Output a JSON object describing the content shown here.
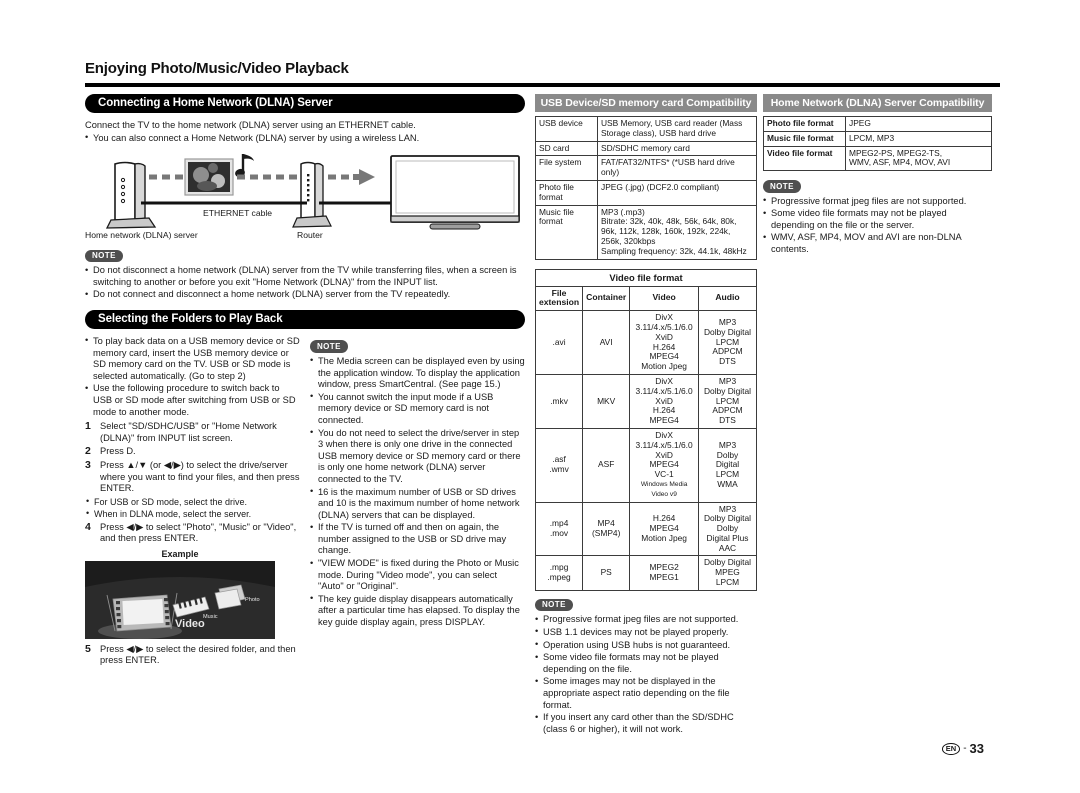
{
  "chapter": {
    "title": "Enjoying Photo/Music/Video Playback"
  },
  "left": {
    "section1_title": "Connecting a Home Network (DLNA) Server",
    "intro_line": "Connect the TV to the home network (DLNA) server using an ETHERNET cable.",
    "intro_bullet": "You can also connect a Home Network (DLNA) server by using a wireless LAN.",
    "diagram": {
      "server_label": "Home network (DLNA) server",
      "cable_label": "ETHERNET cable",
      "router_label": "Router"
    },
    "note_badge": "NOTE",
    "notes": [
      "Do not disconnect a home network (DLNA) server from the TV while transferring files, when a screen is switching to another or before you exit \"Home Network (DLNA)\" from the INPUT list.",
      "Do not connect and disconnect a home network (DLNA) server from the TV repeatedly."
    ],
    "section2_title": "Selecting the Folders to Play Back",
    "pre_bullets": [
      "To play back data on a USB memory device or SD memory card, insert the USB memory device or SD memory card on the TV. USB or SD mode is selected automatically. (Go to step 2)",
      "Use the following procedure to switch back to USB or SD mode after switching from USB or SD mode to another mode."
    ],
    "steps": [
      {
        "num": "1",
        "text": "Select \"SD/SDHC/USB\" or \"Home Network (DLNA)\" from INPUT list screen."
      },
      {
        "num": "2",
        "text": "Press D."
      },
      {
        "num": "3",
        "text": "Press ▲/▼ (or ◀/▶) to select the drive/server where you want to find your files, and then press ENTER.",
        "subs": [
          "For USB or SD mode, select the drive.",
          "When in DLNA mode, select the server."
        ]
      },
      {
        "num": "4",
        "text": "Press ◀/▶ to select \"Photo\", \"Music\" or \"Video\", and then press ENTER."
      },
      {
        "num": "5",
        "text": "Press ◀/▶ to select the desired folder, and then press ENTER."
      }
    ],
    "example_caption": "Example",
    "example_labels": {
      "photo": "Photo",
      "music": "Music",
      "video": "Video"
    },
    "side_note_badge": "NOTE",
    "side_notes": [
      "The Media screen can be displayed even by using the application window. To display the application window, press SmartCentral. (See page 15.)",
      "You cannot switch the input mode if a USB memory device or SD memory card is not connected.",
      "You do not need to select the drive/server in step 3 when there is only one drive in the connected USB memory device or SD memory card or there is only one home network (DLNA) server connected to the TV.",
      "16 is the maximum number of USB or SD drives and 10 is the maximum number of home network (DLNA) servers that can be displayed.",
      "If the TV is turned off and then on again, the number assigned to the USB or SD drive may change.",
      "\"VIEW MODE\" is fixed during the Photo or Music mode. During \"Video mode\", you can select \"Auto\" or \"Original\".",
      "The key guide display disappears automatically after a particular time has elapsed. To display the key guide display again, press DISPLAY."
    ]
  },
  "mid": {
    "usb_table_title": "USB Device/SD memory card Compatibility",
    "usb_rows": [
      {
        "label": "USB device",
        "value": "USB Memory, USB card reader (Mass Storage class), USB hard drive"
      },
      {
        "label": "SD card",
        "value": "SD/SDHC memory card"
      },
      {
        "label": "File system",
        "value": "FAT/FAT32/NTFS* (*USB hard drive only)"
      },
      {
        "label": "Photo file format",
        "value": "JPEG (.jpg) (DCF2.0 compliant)"
      },
      {
        "label": "Music file format",
        "value": "MP3 (.mp3)\nBitrate: 32k, 40k, 48k, 56k, 64k, 80k, 96k, 112k, 128k, 160k, 192k, 224k, 256k, 320kbps\nSampling frequency: 32k, 44.1k, 48kHz"
      }
    ],
    "video_table_title": "Video file format",
    "video_headers": [
      "File extension",
      "Container",
      "Video",
      "Audio"
    ],
    "video_rows": [
      {
        "ext": ".avi",
        "container": "AVI",
        "video": [
          "DivX 3.11/4.x/5.1/6.0",
          "XviD",
          "H.264",
          "MPEG4",
          "Motion Jpeg"
        ],
        "audio": [
          "MP3",
          "Dolby Digital",
          "LPCM",
          "ADPCM",
          "DTS"
        ]
      },
      {
        "ext": ".mkv",
        "container": "MKV",
        "video": [
          "DivX 3.11/4.x/5.1/6.0",
          "XviD",
          "H.264",
          "MPEG4"
        ],
        "audio": [
          "MP3",
          "Dolby Digital",
          "LPCM",
          "ADPCM",
          "DTS"
        ]
      },
      {
        "ext": ".asf\n.wmv",
        "container": "ASF",
        "video": [
          "DivX 3.11/4.x/5.1/6.0",
          "XviD",
          "MPEG4",
          "VC-1",
          "Windows Media Video v9"
        ],
        "audio": [
          "MP3",
          "Dolby",
          "Digital",
          "LPCM",
          "WMA"
        ]
      },
      {
        "ext": ".mp4\n.mov",
        "container": "MP4\n(SMP4)",
        "video": [
          "H.264",
          "MPEG4",
          "Motion Jpeg"
        ],
        "audio": [
          "MP3",
          "Dolby Digital",
          "Dolby",
          "Digital Plus",
          "AAC"
        ]
      },
      {
        "ext": ".mpg\n.mpeg",
        "container": "PS",
        "video": [
          "MPEG2",
          "MPEG1"
        ],
        "audio": [
          "Dolby Digital",
          "MPEG",
          "LPCM"
        ]
      }
    ],
    "note_badge": "NOTE",
    "notes": [
      "Progressive format jpeg files are not supported.",
      "USB 1.1 devices may not be played properly.",
      "Operation using USB hubs is not guaranteed.",
      "Some video file formats may not be played depending on the file.",
      "Some images may not be displayed in the appropriate aspect ratio depending on the file format.",
      "If you insert any card other than the SD/SDHC (class 6 or higher), it will not work."
    ]
  },
  "right": {
    "dlna_table_title": "Home Network (DLNA) Server Compatibility",
    "dlna_rows": [
      {
        "label": "Photo file format",
        "value": "JPEG"
      },
      {
        "label": "Music file format",
        "value": "LPCM, MP3"
      },
      {
        "label": "Video file format",
        "value": "MPEG2-PS, MPEG2-TS,\nWMV, ASF, MP4, MOV, AVI"
      }
    ],
    "note_badge": "NOTE",
    "notes": [
      "Progressive format jpeg files are not supported.",
      "Some video file formats may not be played depending on the file or the server.",
      "WMV, ASF, MP4, MOV and AVI are non-DLNA contents."
    ]
  },
  "footer": {
    "region": "EN",
    "separator": "-",
    "page": "33"
  },
  "colors": {
    "accent_black": "#000000",
    "gray_bar": "#8a8a8a",
    "note_badge": "#4f4f4f"
  }
}
